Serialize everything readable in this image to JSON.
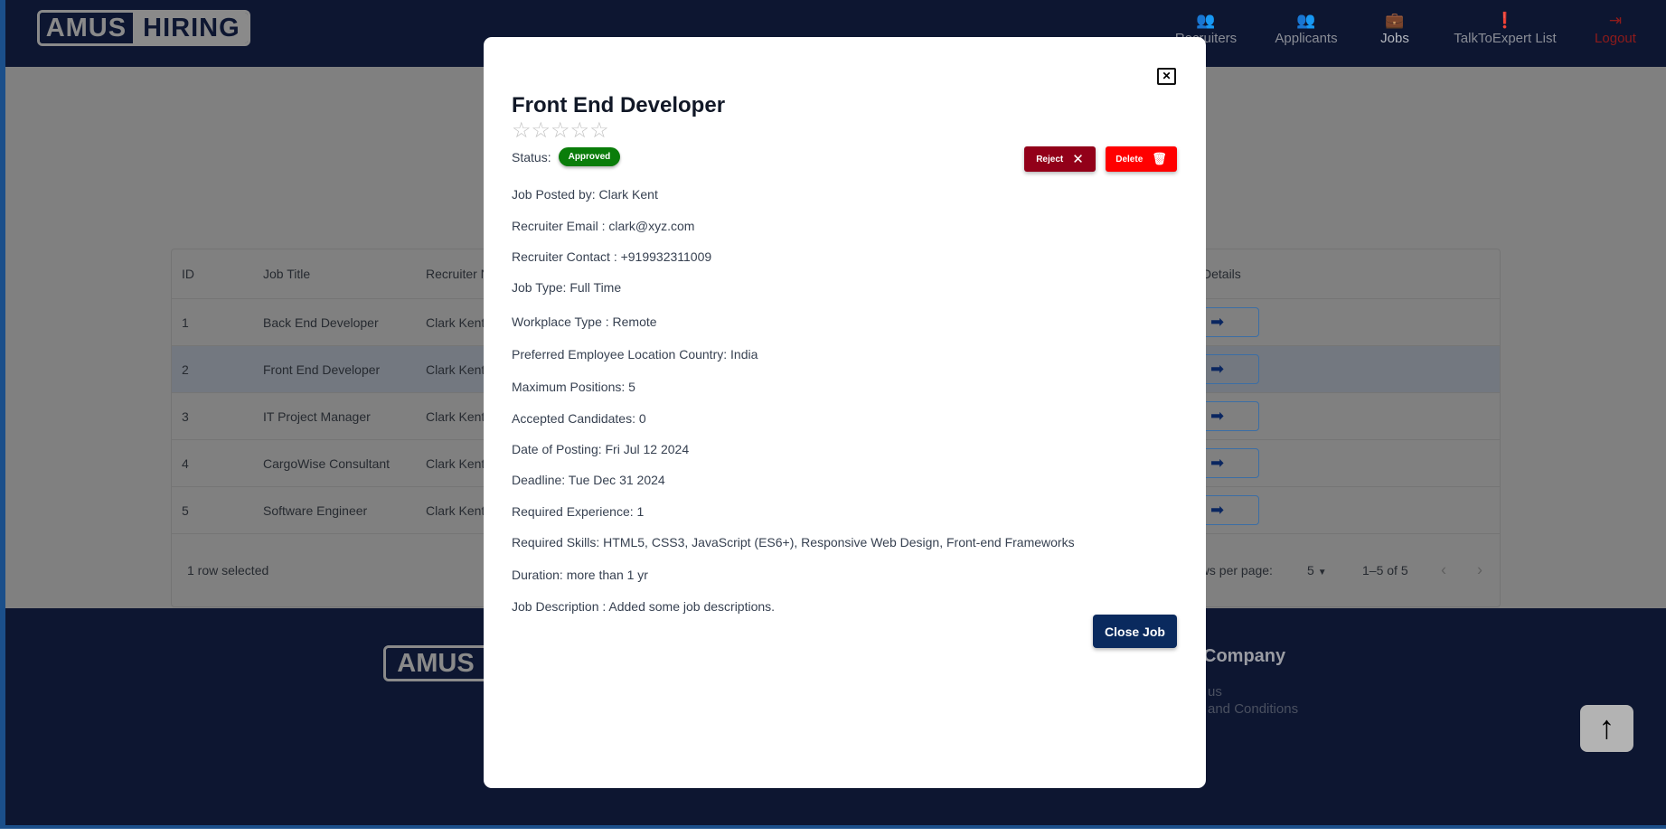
{
  "header": {
    "logo_left": "AMUS",
    "logo_right": "HIRING",
    "nav": [
      {
        "label": "Recruiters",
        "icon": "people-icon"
      },
      {
        "label": "Applicants",
        "icon": "people-icon"
      },
      {
        "label": "Jobs",
        "icon": "briefcase-icon"
      },
      {
        "label": "TalkToExpert List",
        "icon": "chat-alert-icon"
      },
      {
        "label": "Logout",
        "icon": "logout-icon"
      }
    ]
  },
  "table": {
    "headers": [
      "ID",
      "Job Title",
      "Recruiter N",
      "Details"
    ],
    "rows": [
      {
        "id": "1",
        "title": "Back End Developer",
        "recruiter": "Clark Kent"
      },
      {
        "id": "2",
        "title": "Front End Developer",
        "recruiter": "Clark Kent"
      },
      {
        "id": "3",
        "title": "IT Project Manager",
        "recruiter": "Clark Kent"
      },
      {
        "id": "4",
        "title": "CargoWise Consultant",
        "recruiter": "Clark Kent"
      },
      {
        "id": "5",
        "title": "Software Engineer",
        "recruiter": "Clark Kent"
      }
    ],
    "selected_text": "1 row selected",
    "rows_per_page_label": "ows per page:",
    "rows_per_page": "5",
    "range": "1–5 of 5"
  },
  "footer": {
    "logo_left": "AMUS",
    "heading": "Company",
    "links": [
      "us",
      "and Conditions"
    ]
  },
  "modal": {
    "title": "Front End Developer",
    "rating": 0,
    "rating_max": 5,
    "status_label": "Status:",
    "status": "Approved",
    "status_color": "#0a7d0a",
    "reject_label": "Reject",
    "delete_label": "Delete",
    "close_job_label": "Close Job",
    "details": [
      "Job Posted by: Clark Kent",
      "Recruiter Email : clark@xyz.com",
      "Recruiter Contact : +919932311009",
      "Job Type: Full Time",
      "Workplace Type : Remote",
      "Preferred Employee Location Country: India",
      "Maximum Positions: 5",
      "Accepted Candidates: 0",
      "Date of Posting: Fri Jul 12 2024",
      "Deadline: Tue Dec 31 2024",
      "Required Experience: 1",
      "Required Skills: HTML5, CSS3, JavaScript (ES6+), Responsive Web Design, Front-end Frameworks",
      "Duration: more than 1 yr",
      "Job Description : Added some job descriptions."
    ]
  }
}
